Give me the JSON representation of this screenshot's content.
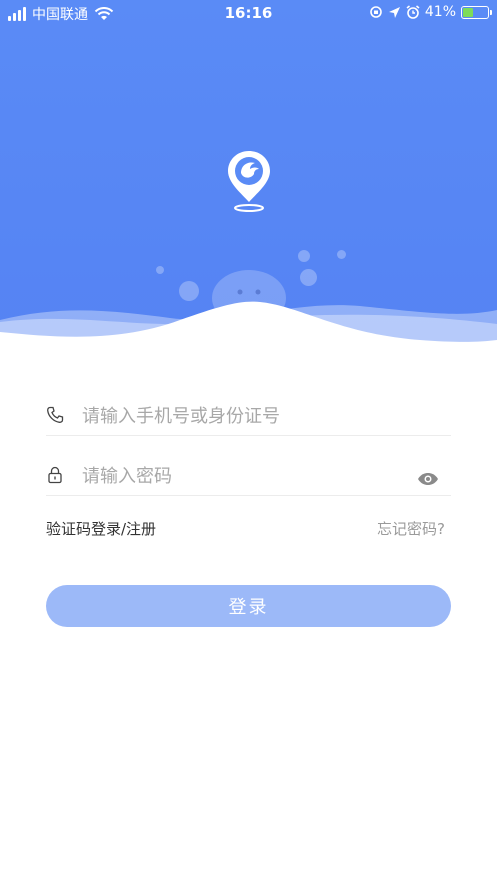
{
  "status_bar": {
    "carrier": "中国联通",
    "time": "16:16",
    "battery_percent": "41%",
    "battery_level": 0.41,
    "icons": [
      "signal-icon",
      "wifi-icon",
      "orientation-lock-icon",
      "location-icon",
      "alarm-icon",
      "battery-icon"
    ]
  },
  "header": {
    "logo_icon": "location-pin-logo-icon",
    "background_color": "#5a8bf6"
  },
  "login_form": {
    "phone_placeholder": "请输入手机号或身份证号",
    "password_placeholder": "请输入密码",
    "phone_icon": "phone-icon",
    "password_icon": "lock-icon",
    "toggle_icon": "eye-icon",
    "sms_login_link": "验证码登录/注册",
    "forgot_password_link": "忘记密码?",
    "login_button": "登录",
    "button_color": "#9cb9f8"
  }
}
